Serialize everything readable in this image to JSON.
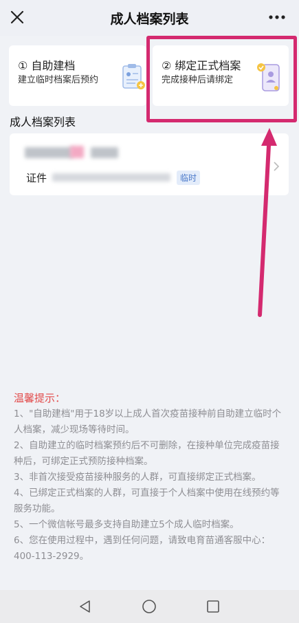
{
  "header": {
    "title": "成人档案列表",
    "close_icon": "close-icon",
    "more_icon": "more-icon"
  },
  "cards": [
    {
      "title": "① 自助建档",
      "subtitle": "建立临时档案后预约",
      "icon": "clipboard-icon"
    },
    {
      "title": "② 绑定正式档案",
      "subtitle": "完成接种后请绑定",
      "icon": "phone-icon"
    }
  ],
  "section_title": "成人档案列表",
  "record": {
    "cert_label": "证件",
    "badge": "临时"
  },
  "tips": {
    "title": "温馨提示：",
    "items": [
      "1、\"自助建档\"用于18岁以上成人首次疫苗接种前自助建立临时个人档案，减少现场等待时间。",
      "2、自助建立的临时档案预约后不可删除，在接种单位完成疫苗接种后，可绑定正式预防接种档案。",
      "3、非首次接受疫苗接种服务的人群，可直接绑定正式档案。",
      "4、已绑定正式档案的人群，可直接于个人档案中使用在线预约等服务功能。",
      "5、一个微信帐号最多支持自助建立5个成人临时档案。",
      "6、您在使用过程中，遇到任何问题，请致电育苗通客服中心：400-113-2929。"
    ]
  },
  "colors": {
    "highlight": "#d42a6f",
    "tips_title": "#e24a4a",
    "badge_text": "#4a78c9"
  },
  "system_nav": [
    "back-icon",
    "home-icon",
    "recents-icon"
  ]
}
